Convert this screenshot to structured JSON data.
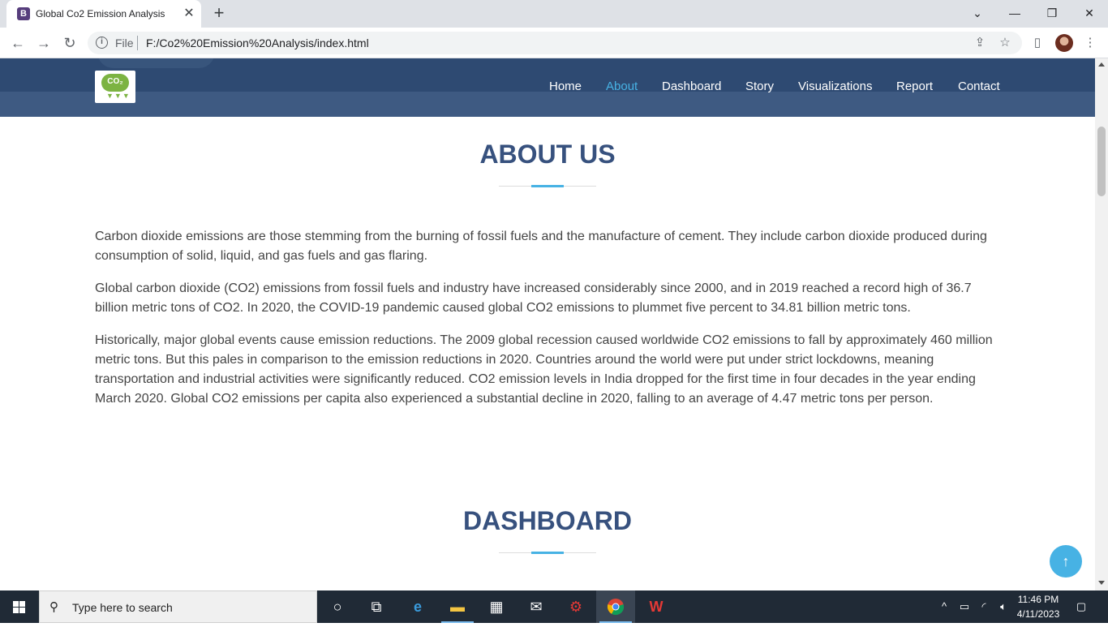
{
  "browser": {
    "tab_title": "Global Co2 Emission Analysis",
    "tab_favicon_letter": "B",
    "address_prefix": "File",
    "url": "F:/Co2%20Emission%20Analysis/index.html"
  },
  "site": {
    "logo_text": "CO₂",
    "nav": [
      {
        "label": "Home",
        "active": false
      },
      {
        "label": "About",
        "active": true
      },
      {
        "label": "Dashboard",
        "active": false
      },
      {
        "label": "Story",
        "active": false
      },
      {
        "label": "Visualizations",
        "active": false
      },
      {
        "label": "Report",
        "active": false
      },
      {
        "label": "Contact",
        "active": false
      }
    ],
    "colors": {
      "header": "#2e4a72",
      "accent": "#47b2e4",
      "heading": "#37517e"
    }
  },
  "about": {
    "title": "ABOUT US",
    "paragraphs": [
      "Carbon dioxide emissions are those stemming from the burning of fossil fuels and the manufacture of cement. They include carbon dioxide produced during consumption of solid, liquid, and gas fuels and gas flaring.",
      "Global carbon dioxide (CO2) emissions from fossil fuels and industry have increased considerably since 2000, and in 2019 reached a record high of 36.7 billion metric tons of CO2. In 2020, the COVID-19 pandemic caused global CO2 emissions to plummet five percent to 34.81 billion metric tons.",
      "Historically, major global events cause emission reductions. The 2009 global recession caused worldwide CO2 emissions to fall by approximately 460 million metric tons. But this pales in comparison to the emission reductions in 2020. Countries around the world were put under strict lockdowns, meaning transportation and industrial activities were significantly reduced. CO2 emission levels in India dropped for the first time in four decades in the year ending March 2020. Global CO2 emissions per capita also experienced a substantial decline in 2020, falling to an average of 4.47 metric tons per person."
    ]
  },
  "dashboard": {
    "title": "DASHBOARD"
  },
  "taskbar": {
    "search_placeholder": "Type here to search",
    "time": "11:46 PM",
    "date": "4/11/2023"
  }
}
